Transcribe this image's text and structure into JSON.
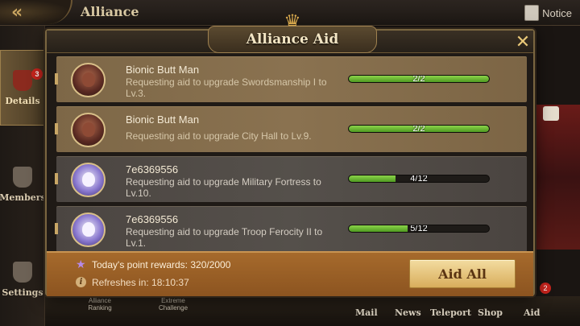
{
  "topbar": {
    "title": "Alliance",
    "notice_label": "Notice"
  },
  "sidebar": {
    "items": [
      {
        "label": "Details",
        "badge": "3"
      },
      {
        "label": "Members"
      },
      {
        "label": "Settings"
      }
    ]
  },
  "bottom_nav": {
    "left_items": [
      "Alliance\nRanking",
      "Extreme\nChallenge"
    ],
    "items": [
      "Mail",
      "News",
      "Teleport",
      "Shop",
      "Aid"
    ],
    "aid_badge": "2"
  },
  "modal": {
    "title": "Alliance Aid",
    "requests": [
      {
        "player": "Bionic Butt Man",
        "request": "Requesting aid to upgrade Swordsmanship I to Lv.3.",
        "current": 2,
        "total": 2,
        "progress_label": "2/2",
        "avatar": "warrior-avatar"
      },
      {
        "player": "Bionic Butt Man",
        "request": "Requesting aid to upgrade City Hall to Lv.9.",
        "current": 2,
        "total": 2,
        "progress_label": "2/2",
        "avatar": "warrior-avatar"
      },
      {
        "player": "7e6369556",
        "request": "Requesting aid to upgrade Military Fortress to Lv.10.",
        "current": 4,
        "total": 12,
        "progress_label": "4/12",
        "avatar": "mage-avatar"
      },
      {
        "player": "7e6369556",
        "request": "Requesting aid to upgrade Troop Ferocity II to Lv.1.",
        "current": 5,
        "total": 12,
        "progress_label": "5/12",
        "avatar": "mage-avatar"
      }
    ],
    "footer": {
      "points_text": "Today's point rewards: 320/2000",
      "refresh_text": "Refreshes in: 18:10:37",
      "aid_all_label": "Aid All"
    }
  }
}
